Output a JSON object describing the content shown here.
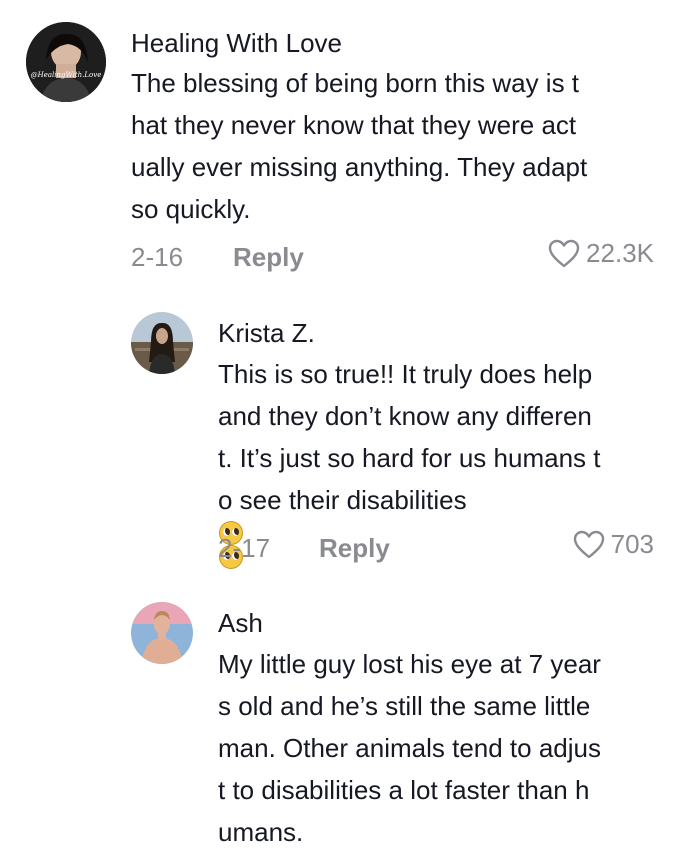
{
  "comments": [
    {
      "author": "Healing With Love",
      "avatar_caption": "@HealingWith.Love",
      "lines": [
        "The blessing of being born this way is t",
        "hat they never know that they were act",
        "ually ever missing anything. They adapt",
        "so quickly."
      ],
      "date": "2-16",
      "reply_label": "Reply",
      "likes": "22.3K"
    },
    {
      "author": "Krista Z.",
      "lines": [
        "This is so true!! It truly does help",
        "and they don’t know any differen",
        "t. It’s just so hard for us humans t",
        "o see their disabilities"
      ],
      "emoji_icons": [
        "pleading-face-emoji",
        "pleading-face-emoji"
      ],
      "date": "2-17",
      "reply_label": "Reply",
      "likes": "703"
    },
    {
      "author": "Ash",
      "lines": [
        "My little guy lost his eye at 7 year",
        "s old and he’s still the same little",
        "man. Other animals tend to adjus",
        "t to disabilities a lot faster than h",
        "umans."
      ]
    }
  ],
  "icons": {
    "like": "heart-outline-icon"
  },
  "colors": {
    "text": "#161823",
    "muted": "#8a8b91"
  }
}
